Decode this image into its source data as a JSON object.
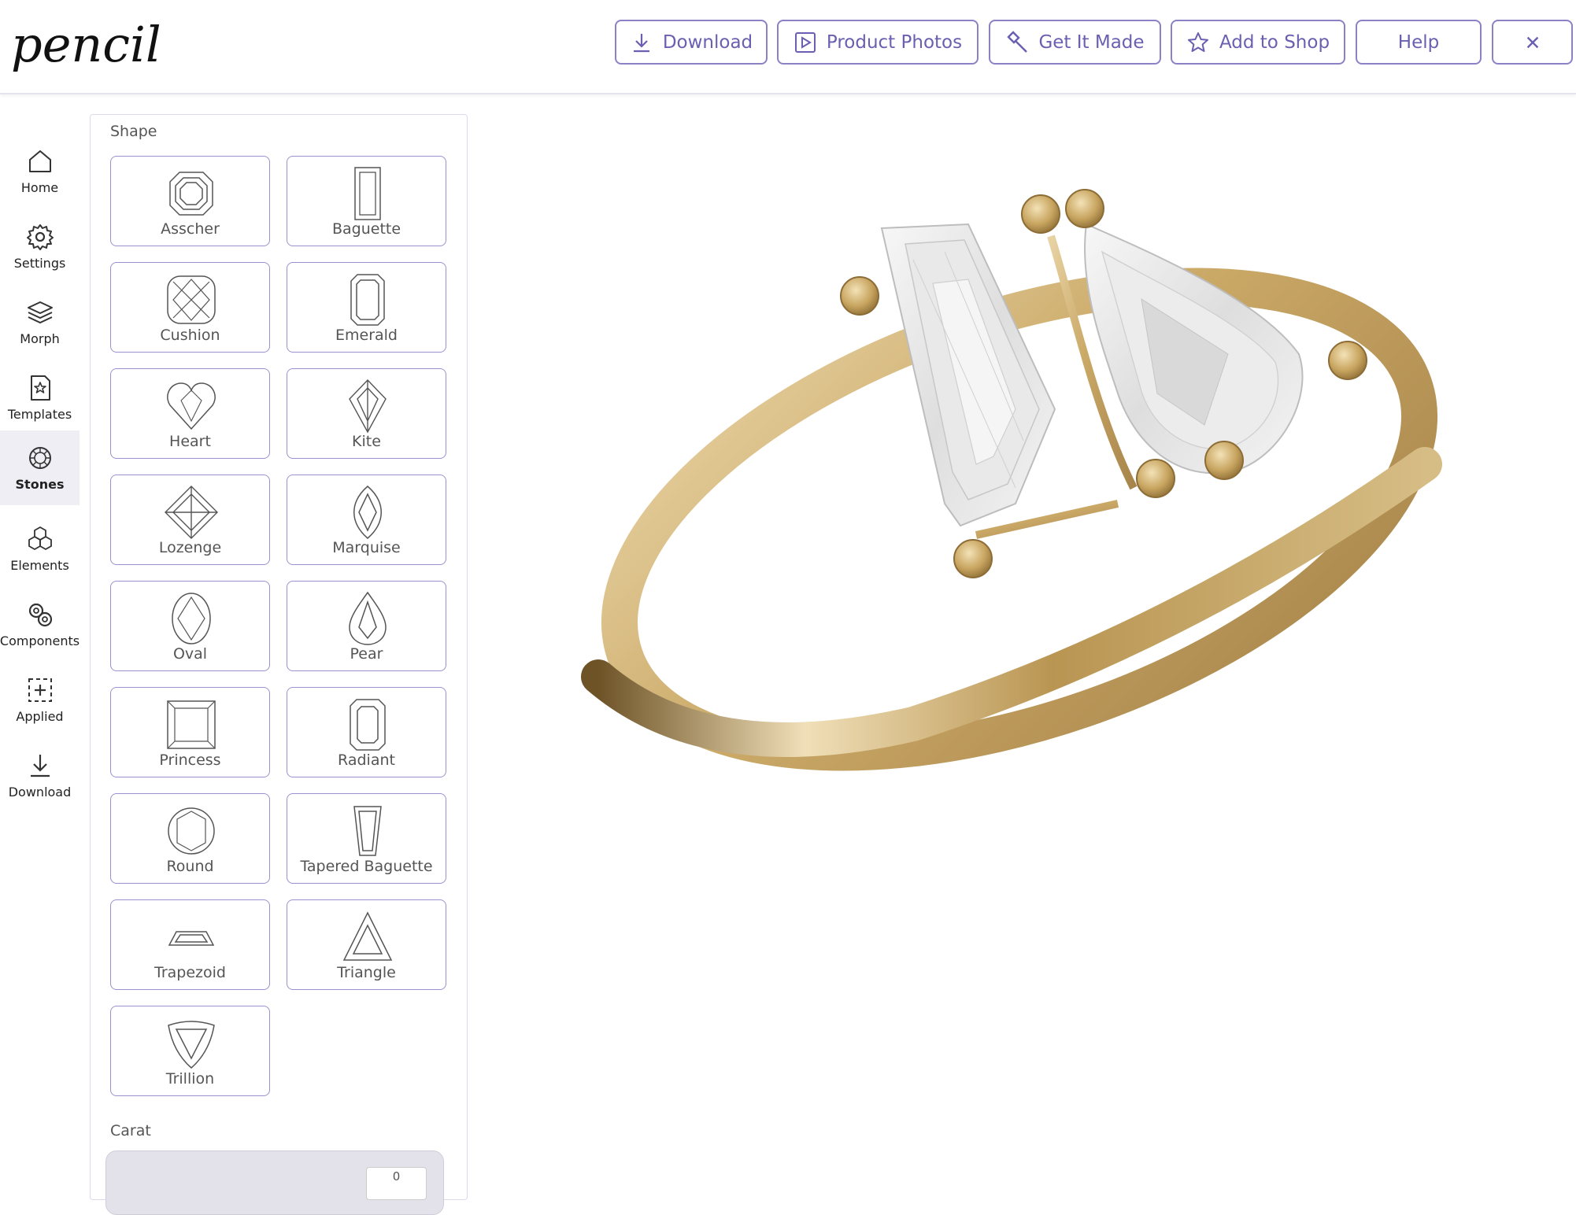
{
  "app": {
    "logo_text": "pencil"
  },
  "toolbar": {
    "download_label": "Download",
    "product_photos_label": "Product Photos",
    "get_it_made_label": "Get It Made",
    "add_to_shop_label": "Add to Shop",
    "help_label": "Help"
  },
  "sidebar": {
    "items": [
      {
        "label": "Home",
        "icon": "home-icon"
      },
      {
        "label": "Settings",
        "icon": "gear-icon"
      },
      {
        "label": "Morph",
        "icon": "layers-icon"
      },
      {
        "label": "Templates",
        "icon": "template-icon"
      },
      {
        "label": "Stones",
        "icon": "stone-icon",
        "active": true
      },
      {
        "label": "Elements",
        "icon": "elements-icon"
      },
      {
        "label": "Components",
        "icon": "components-icon"
      },
      {
        "label": "Applied",
        "icon": "applied-icon"
      },
      {
        "label": "Download",
        "icon": "download-icon"
      }
    ]
  },
  "panel": {
    "shape_title": "Shape",
    "shapes": [
      "Asscher",
      "Baguette",
      "Cushion",
      "Emerald",
      "Heart",
      "Kite",
      "Lozenge",
      "Marquise",
      "Oval",
      "Pear",
      "Princess",
      "Radiant",
      "Round",
      "Tapered Baguette",
      "Trapezoid",
      "Triangle",
      "Trillion"
    ],
    "carat_title": "Carat",
    "carat_value": "0"
  },
  "colors": {
    "accent": "#6a5fb0",
    "button_border": "#8b82c6",
    "gold": "#c9a867",
    "active_bg": "#efeef4"
  }
}
